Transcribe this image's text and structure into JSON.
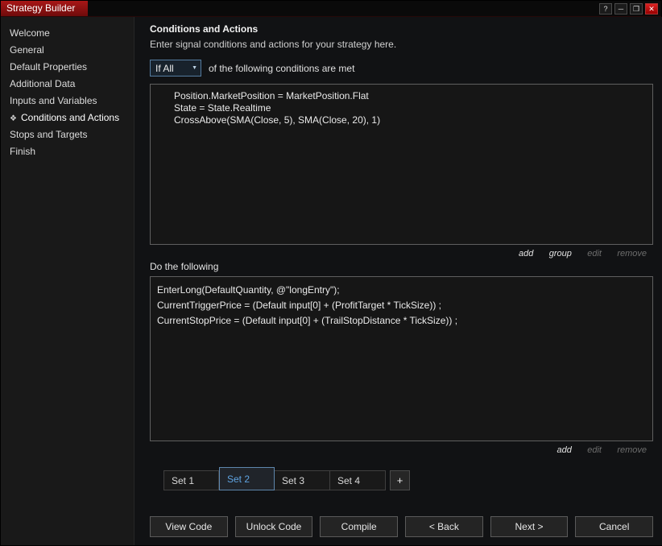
{
  "window": {
    "title": "Strategy Builder",
    "controls": {
      "help": "?",
      "minimize": "─",
      "maximize": "❐",
      "close": "✕"
    }
  },
  "icons": {
    "chevron_down": "▼",
    "selected_marker": "❖"
  },
  "sidebar": {
    "items": [
      {
        "label": "Welcome",
        "selected": false
      },
      {
        "label": "General",
        "selected": false
      },
      {
        "label": "Default Properties",
        "selected": false
      },
      {
        "label": "Additional Data",
        "selected": false
      },
      {
        "label": "Inputs and Variables",
        "selected": false
      },
      {
        "label": "Conditions and Actions",
        "selected": true
      },
      {
        "label": "Stops and Targets",
        "selected": false
      },
      {
        "label": "Finish",
        "selected": false
      }
    ]
  },
  "main": {
    "title": "Conditions and Actions",
    "subtitle": "Enter signal conditions and actions for your strategy here.",
    "conditions": {
      "dropdown_value": "If All",
      "header_suffix": "of the following conditions are met",
      "items": [
        "Position.MarketPosition = MarketPosition.Flat",
        "State = State.Realtime",
        "CrossAbove(SMA(Close, 5), SMA(Close, 20), 1)"
      ],
      "links": [
        {
          "label": "add",
          "enabled": true
        },
        {
          "label": "group",
          "enabled": true
        },
        {
          "label": "edit",
          "enabled": false
        },
        {
          "label": "remove",
          "enabled": false
        }
      ]
    },
    "actions": {
      "label": "Do the following",
      "items": [
        "EnterLong(DefaultQuantity, @\"longEntry\");",
        "CurrentTriggerPrice = (Default input[0] + (ProfitTarget * TickSize)) ;",
        "CurrentStopPrice = (Default input[0] + (TrailStopDistance * TickSize)) ;"
      ],
      "links": [
        {
          "label": "add",
          "enabled": true
        },
        {
          "label": "edit",
          "enabled": false
        },
        {
          "label": "remove",
          "enabled": false
        }
      ]
    },
    "tabs": [
      {
        "label": "Set 1",
        "selected": false
      },
      {
        "label": "Set 2",
        "selected": true
      },
      {
        "label": "Set 3",
        "selected": false
      },
      {
        "label": "Set 4",
        "selected": false
      }
    ],
    "add_tab_label": "+",
    "buttons": {
      "view_code": "View Code",
      "unlock_code": "Unlock Code",
      "compile": "Compile",
      "back": "< Back",
      "next": "Next >",
      "cancel": "Cancel"
    }
  }
}
